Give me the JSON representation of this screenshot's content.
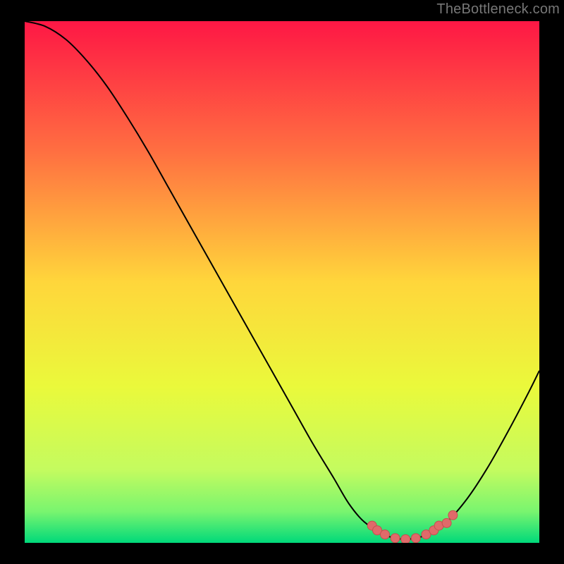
{
  "watermark": "TheBottleneck.com",
  "colors": {
    "bg": "#000000",
    "grad_top": "#fe1745",
    "grad_25": "#ff6f41",
    "grad_50": "#ffd63b",
    "grad_70": "#eaf93b",
    "grad_85": "#c4fb5f",
    "grad_92": "#79f56f",
    "grad_100": "#00d97a",
    "curve": "#000000",
    "marker_fill": "#e06a6a",
    "marker_stroke": "#c64f4f"
  },
  "chart_data": {
    "type": "line",
    "title": "",
    "xlabel": "",
    "ylabel": "",
    "xlim": [
      0,
      100
    ],
    "ylim": [
      0,
      100
    ],
    "series": [
      {
        "name": "bottleneck-curve",
        "x": [
          0,
          4,
          8,
          12,
          16,
          20,
          24,
          28,
          32,
          36,
          40,
          44,
          48,
          52,
          56,
          60,
          63,
          66,
          70,
          74,
          78,
          82,
          86,
          90,
          94,
          98,
          100
        ],
        "y": [
          100,
          99,
          96.5,
          92.5,
          87.5,
          81.5,
          75,
          68,
          61,
          54,
          47,
          40,
          33,
          26,
          19,
          12.5,
          7.5,
          4,
          1.5,
          0.7,
          1.5,
          4,
          8.5,
          14.5,
          21.5,
          29,
          33
        ]
      }
    ],
    "markers": {
      "name": "recommended-zone",
      "points": [
        {
          "x": 67.5,
          "y": 3.3
        },
        {
          "x": 68.5,
          "y": 2.4
        },
        {
          "x": 70.0,
          "y": 1.6
        },
        {
          "x": 72.0,
          "y": 0.9
        },
        {
          "x": 74.0,
          "y": 0.7
        },
        {
          "x": 76.0,
          "y": 0.9
        },
        {
          "x": 78.0,
          "y": 1.6
        },
        {
          "x": 79.5,
          "y": 2.4
        },
        {
          "x": 80.5,
          "y": 3.3
        },
        {
          "x": 82.0,
          "y": 3.8
        },
        {
          "x": 83.2,
          "y": 5.3
        }
      ]
    }
  }
}
